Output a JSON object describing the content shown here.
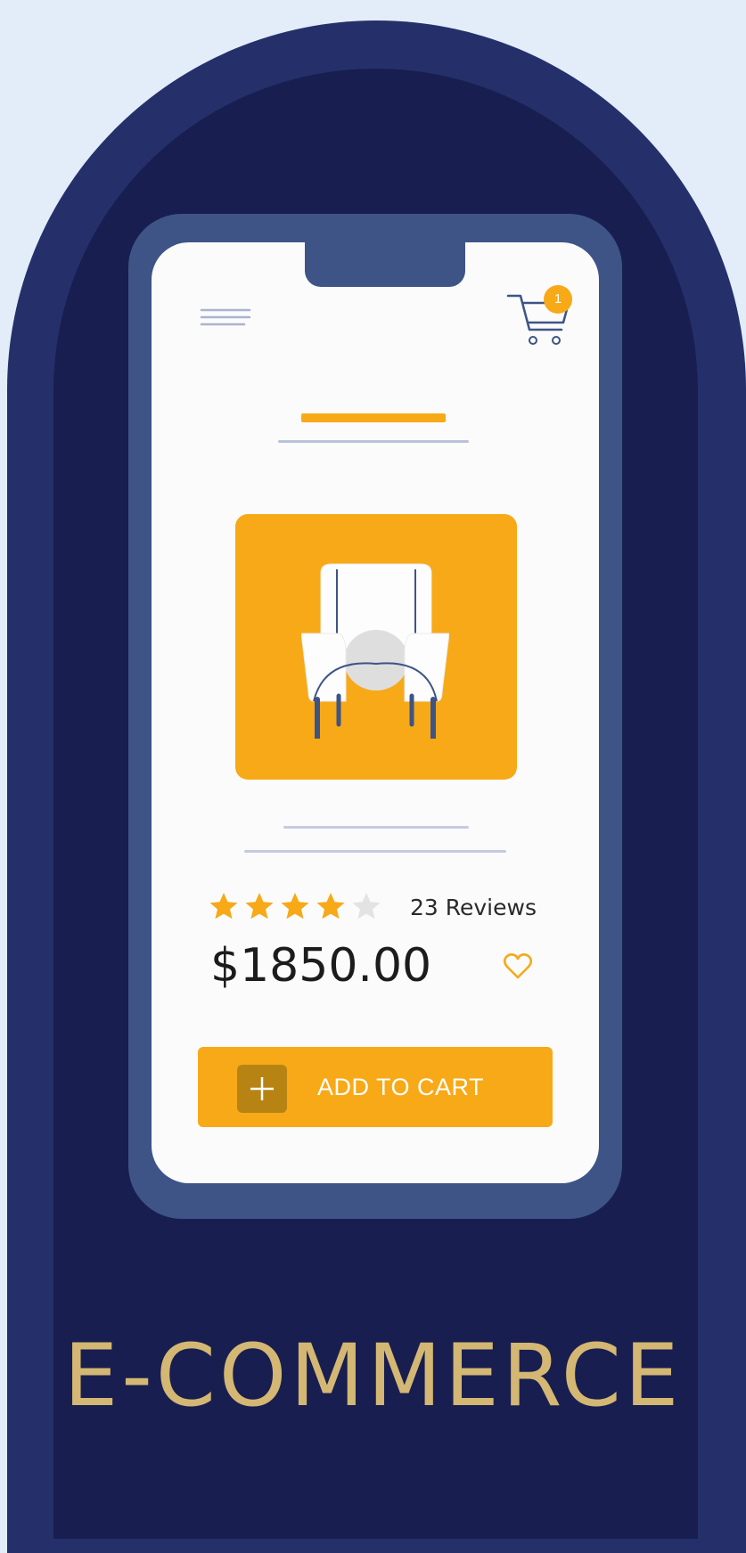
{
  "colors": {
    "background": "#e2edf9",
    "arch_outer": "#25306b",
    "arch_inner": "#181e50",
    "phone_frame": "#3e5486",
    "accent": "#f7a917",
    "label_gold": "#d3b773"
  },
  "header": {
    "menu_icon": "hamburger-menu-icon",
    "cart_icon": "shopping-cart-icon",
    "cart_count": "1"
  },
  "product": {
    "image_icon": "armchair-icon",
    "rating": 4,
    "rating_max": 5,
    "reviews_label": "23 Reviews",
    "price": "$1850.00",
    "favorite_icon": "heart-icon"
  },
  "actions": {
    "add_icon": "plus-icon",
    "add_to_cart_label": "ADD TO CART"
  },
  "category_label": "E-COMMERCE"
}
